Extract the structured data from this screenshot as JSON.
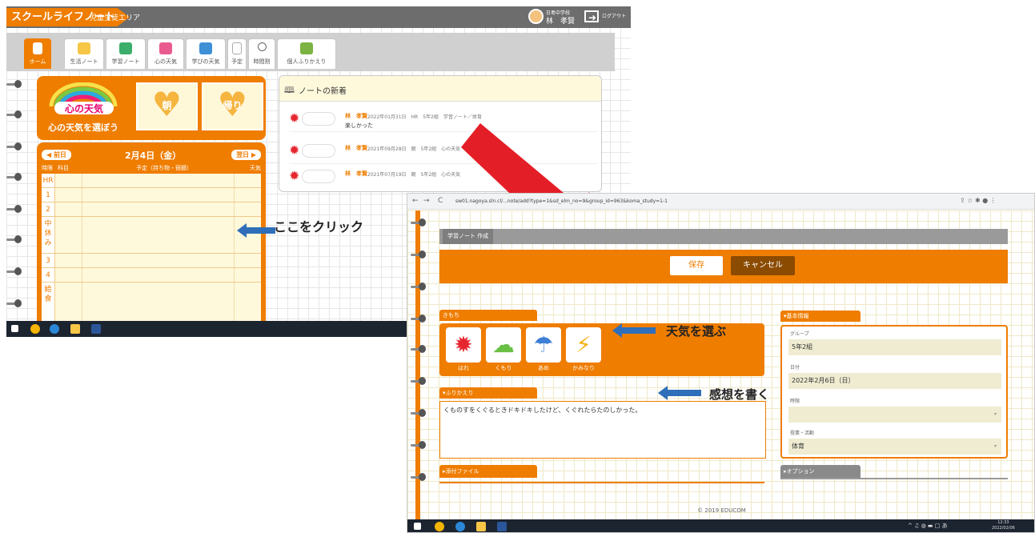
{
  "colors": {
    "accent": "#ef7d00",
    "callout_arrow": "#2f6fb9",
    "big_arrow": "#e41e26",
    "topbar": "#6d6d6d"
  },
  "shot1": {
    "app_title": "スクールライフノート",
    "area": "児童生徒エリア",
    "user_school": "日島中学校",
    "user_name": "林　孝賢",
    "logout": "ログアウト",
    "tabs": [
      {
        "label": "ホーム",
        "icon": "home-icon"
      },
      {
        "label": "生活ノート",
        "icon": "life-note-icon"
      },
      {
        "label": "学習ノート",
        "icon": "study-note-icon"
      },
      {
        "label": "心の天気",
        "icon": "mind-weather-icon"
      },
      {
        "label": "学びの天気",
        "icon": "learning-weather-icon"
      },
      {
        "label": "予定",
        "icon": "calendar-icon"
      },
      {
        "label": "時間割",
        "icon": "clock-icon"
      },
      {
        "label": "個人ふりかえり",
        "icon": "book-icon"
      }
    ],
    "weather": {
      "logo_text": "心の天気",
      "choose": "心の天気を選ぼう",
      "morning": "朝",
      "return": "帰り"
    },
    "schedule": {
      "prev": "◀ 前日",
      "next": "翌日 ▶",
      "date": "2月4日（金）",
      "headers": {
        "period": "時限",
        "subject": "科目",
        "plan": "予定（持ち物・宿題）",
        "weather": "天気"
      },
      "periods": [
        "HR",
        "1",
        "2",
        "中\n休\nみ",
        "3",
        "4",
        "給\n食"
      ]
    },
    "news": {
      "title": "ノートの新着",
      "items": [
        {
          "name": "林　孝賢",
          "meta": "2022年01月31日　HR　5年2組　学習ノート／体育",
          "body": "楽しかった"
        },
        {
          "name": "林　孝賢",
          "meta": "2021年09月28日　朝　5年2組　心の天気",
          "body": ""
        },
        {
          "name": "林　孝賢",
          "meta": "2021年07月19日　朝　5年2組　心の天気",
          "body": ""
        }
      ]
    },
    "callout": "ここをクリック"
  },
  "shot2": {
    "url": "sw01.nagoya.sln.cl/...note/add?type=1&sd_elm_no=9&group_id=963&koma_study=1-1",
    "page_label": "学習ノート 作成",
    "save": "保存",
    "cancel": "キャンセル",
    "kimochi_title": "きもち",
    "weathers": [
      {
        "label": "はれ",
        "icon": "sun-icon"
      },
      {
        "label": "くもり",
        "icon": "cloud-icon"
      },
      {
        "label": "あめ",
        "icon": "umbrella-icon"
      },
      {
        "label": "かみなり",
        "icon": "lightning-icon"
      }
    ],
    "callout_weather": "天気を選ぶ",
    "furikaeri_title": "▾ふりかえり",
    "furikaeri_text": "くものすをくぐるときドキドキしたけど、くぐれたらたのしかった。",
    "callout_comment": "感想を書く",
    "attach_title": "▸添付ファイル",
    "info_title": "▾基本情報",
    "fields": [
      {
        "label": "グループ",
        "value": "5年2組"
      },
      {
        "label": "日付",
        "value": "2022年2月6日（日）"
      },
      {
        "label": "時限",
        "value": ""
      },
      {
        "label": "授業・活動",
        "value": "体育"
      }
    ],
    "option_title": "▸オプション",
    "copyright": "© 2019 EDUCOM",
    "clock_time": "12:33",
    "clock_date": "2022/02/06",
    "ime": "あ"
  }
}
